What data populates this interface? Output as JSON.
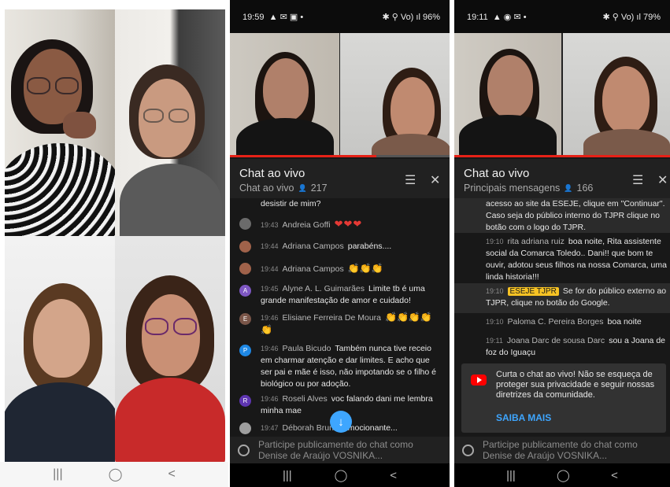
{
  "phone1": {
    "nav": {
      "recent": "|||",
      "home": "◯",
      "back": "<"
    }
  },
  "phone2": {
    "status": {
      "time": "19:59",
      "left_icons": "▲ ✉ ▣ •",
      "right_icons": "✱ ⚲ Vo) ıl",
      "battery": "96%"
    },
    "chat": {
      "title": "Chat ao vivo",
      "mode": "Chat ao vivo",
      "viewers": "217"
    },
    "messages": [
      {
        "text": "desistir de mim?"
      },
      {
        "time": "19:43",
        "author": "Andreia Goffi",
        "text": "❤❤❤",
        "avatar_color": "#6b6b6b"
      },
      {
        "time": "19:44",
        "author": "Adriana Campos",
        "text": "parabéns....",
        "avatar_color": "#a0624a"
      },
      {
        "time": "19:44",
        "author": "Adriana Campos",
        "text": "👏👏👏",
        "avatar_color": "#a0624a"
      },
      {
        "time": "19:45",
        "author": "Alyne A. L. Guimarães",
        "text": "Limite tb é uma grande manifestação de amor e cuidado!",
        "avatar_letter": "A",
        "avatar_color": "#7e57c2"
      },
      {
        "time": "19:46",
        "author": "Elisiane Ferreira De Moura",
        "text": "👏👏👏👏 👏",
        "avatar_letter": "E",
        "avatar_color": "#795548"
      },
      {
        "time": "19:46",
        "author": "Paula Bicudo",
        "text": "Também nunca tive receio em charmar atenção e dar limites. E acho que ser pai e mãe é isso, não impotando se o filho é biológico ou por adoção.",
        "avatar_letter": "P",
        "avatar_color": "#1e88e5"
      },
      {
        "time": "19:46",
        "author": "Roseli Alves",
        "text": "voc falando dani me lembra minha mae",
        "avatar_letter": "R",
        "avatar_color": "#5e35b1"
      },
      {
        "time": "19:47",
        "author": "Déborah Bruno",
        "text": "Emocionante...",
        "avatar_color": "#9e9e9e"
      }
    ],
    "input_placeholder": "Participe publicamente do chat como Denise de Araújo VOSNIKA...",
    "nav": {
      "recent": "|||",
      "home": "◯",
      "back": "<"
    }
  },
  "phone3": {
    "status": {
      "time": "19:11",
      "left_icons": "▲ ◉ ✉ •",
      "right_icons": "✱ ⚲ Vo) ıl",
      "battery": "79%"
    },
    "chat": {
      "title": "Chat ao vivo",
      "mode": "Principais mensagens",
      "viewers": "166"
    },
    "messages": [
      {
        "text": "acesso ao site da ESEJE, clique em \"Continuar\". Caso seja do público interno do TJPR clique no botão com o logo do TJPR."
      },
      {
        "time": "19:10",
        "author": "rita adriana ruiz",
        "text": "boa noite, Rita assistente social da Comarca Toledo.. Dani!! que bom te ouvir, adotou seus filhos na nossa Comarca, uma linda historia!!!"
      },
      {
        "time": "19:10",
        "badge": "ESEJE TJPR",
        "text": "Se for do público externo ao TJPR, clique no botão do Google."
      },
      {
        "time": "19:10",
        "author": "Paloma C. Pereira Borges",
        "text": "boa noite"
      },
      {
        "time": "19:11",
        "author": "Joana Darc de sousa Darc",
        "text": "sou a Joana de foz do Iguaçu"
      }
    ],
    "info_card": {
      "text": "Curta o chat ao vivo! Não se esqueça de proteger sua privacidade e seguir nossas diretrizes da comunidade.",
      "link": "SAIBA MAIS"
    },
    "input_placeholder": "Participe publicamente do chat como Denise de Araújo VOSNIKA...",
    "nav": {
      "recent": "|||",
      "home": "◯",
      "back": "<"
    }
  },
  "colors": {
    "accent_blue": "#3ea6ff",
    "youtube_red": "#ff0000",
    "badge_yellow": "#f6c224"
  }
}
